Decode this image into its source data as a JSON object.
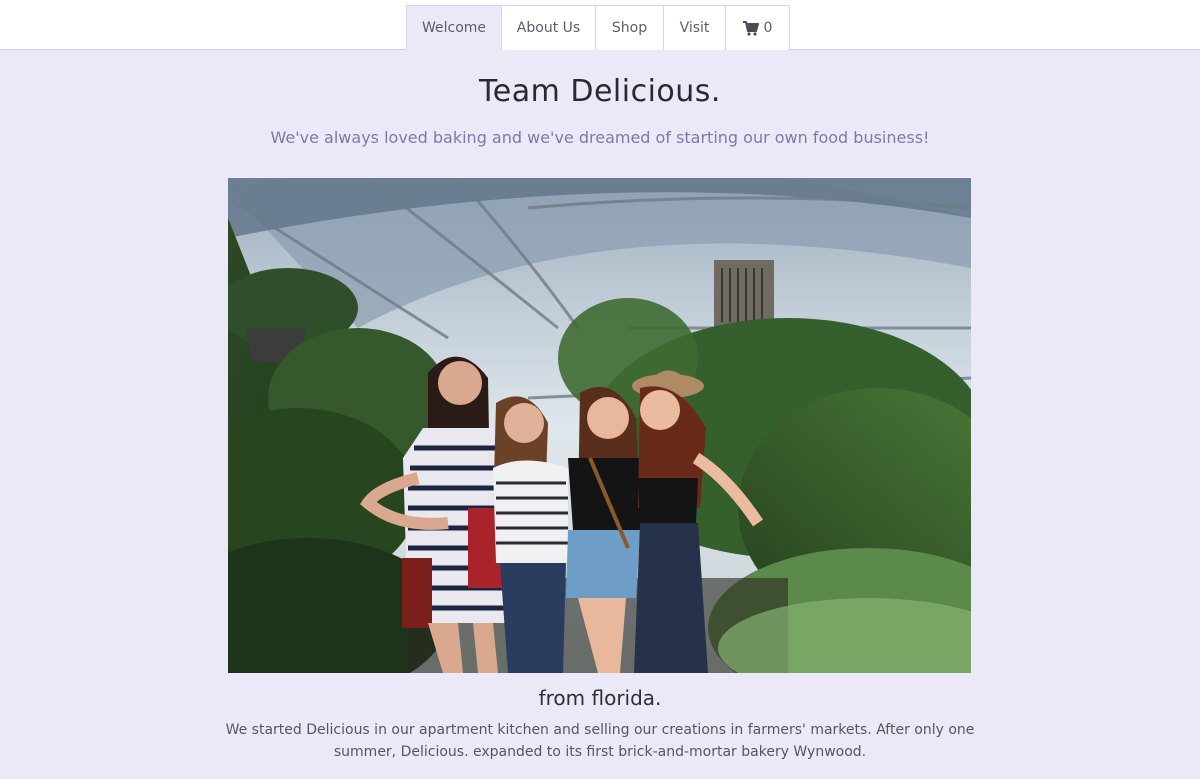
{
  "nav": {
    "items": [
      {
        "label": "Welcome"
      },
      {
        "label": "About Us"
      },
      {
        "label": "Shop"
      },
      {
        "label": "Visit"
      }
    ],
    "cart_count": "0",
    "cart_icon": "shopping-cart-icon"
  },
  "hero": {
    "title": "Team Delicious.",
    "subtitle": "We've always loved baking and we've dreamed of starting our own food business!"
  },
  "section": {
    "caption": "from florida.",
    "body": "We started Delicious in our apartment kitchen and selling our creations in farmers' markets. After only one summer, Delicious. expanded to its first brick-and-mortar bakery Wynwood."
  },
  "colors": {
    "background": "#ebe9f7",
    "nav_active": "#ebe9f7",
    "subtitle": "#7d7aa6"
  }
}
